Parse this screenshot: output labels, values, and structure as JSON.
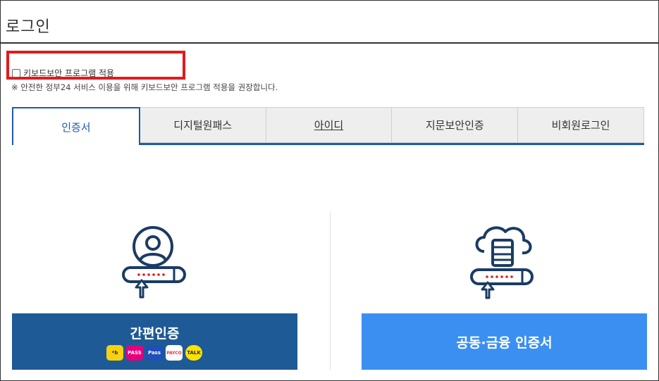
{
  "page": {
    "title": "로그인"
  },
  "keyboard_security": {
    "label": "키보드보안 프로그램 적용",
    "checked": false
  },
  "notice": "※ 안전한 정부24 서비스 이용을 위해 키보드보안 프로그램 적용을 권장합니다.",
  "tabs": [
    {
      "label": "인증서",
      "active": true
    },
    {
      "label": "디지털원패스",
      "active": false
    },
    {
      "label": "아이디",
      "active": false
    },
    {
      "label": "지문보안인증",
      "active": false
    },
    {
      "label": "비회원로그인",
      "active": false
    }
  ],
  "methods": {
    "simple_auth": {
      "label": "간편인증",
      "icon": "user-password-icon",
      "providers": [
        {
          "name": "kakao",
          "icon": "kakao-icon",
          "text": "*b",
          "color": "#f7d20f"
        },
        {
          "name": "pass",
          "icon": "pass-icon",
          "text": "PASS",
          "color": "#e6007e"
        },
        {
          "name": "samsung-pass",
          "icon": "samsung-pass-icon",
          "text": "Pass",
          "color": "#1f4fb8"
        },
        {
          "name": "payco",
          "icon": "payco-icon",
          "text": "PAYCO",
          "color": "#e8343a"
        },
        {
          "name": "kakaotalk",
          "icon": "talk-icon",
          "text": "TALK",
          "color": "#fbe300"
        }
      ]
    },
    "joint_cert": {
      "label": "공동·금융 인증서",
      "icon": "cloud-server-password-icon"
    }
  },
  "colors": {
    "primary": "#1e5a96",
    "accent": "#3a8ff0",
    "tab_active": "#1e5ba8",
    "highlight_box": "#e21b1b"
  }
}
